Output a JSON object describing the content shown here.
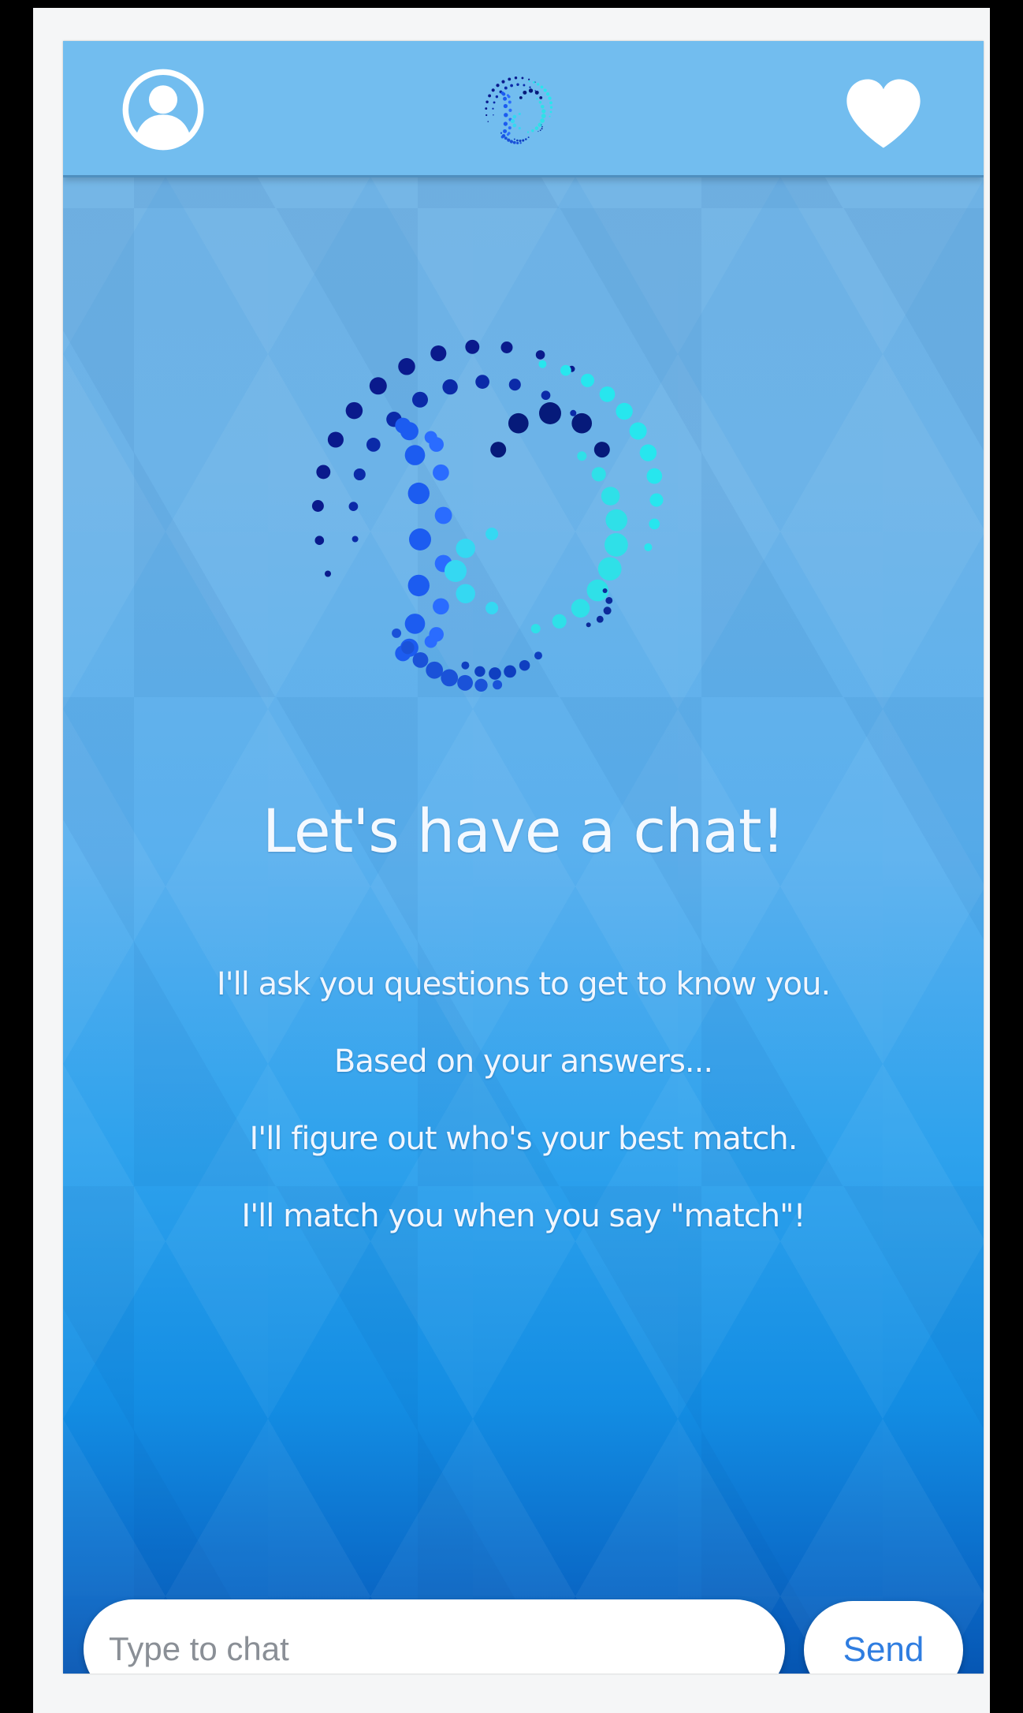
{
  "header": {
    "profile_icon": "user-circle-icon",
    "logo_icon": "dotted-heart-logo-icon",
    "favorites_icon": "heart-icon",
    "color": "#72bdef"
  },
  "intro": {
    "headline": "Let's have a chat!",
    "lines": [
      "I'll ask you questions to get to know you.",
      "Based on your answers...",
      "I'll figure out who's your best match.",
      "I'll match you when you say \"match\"!"
    ]
  },
  "composer": {
    "placeholder": "Type to chat",
    "value": "",
    "send_label": "Send",
    "send_color": "#2f7de0"
  }
}
